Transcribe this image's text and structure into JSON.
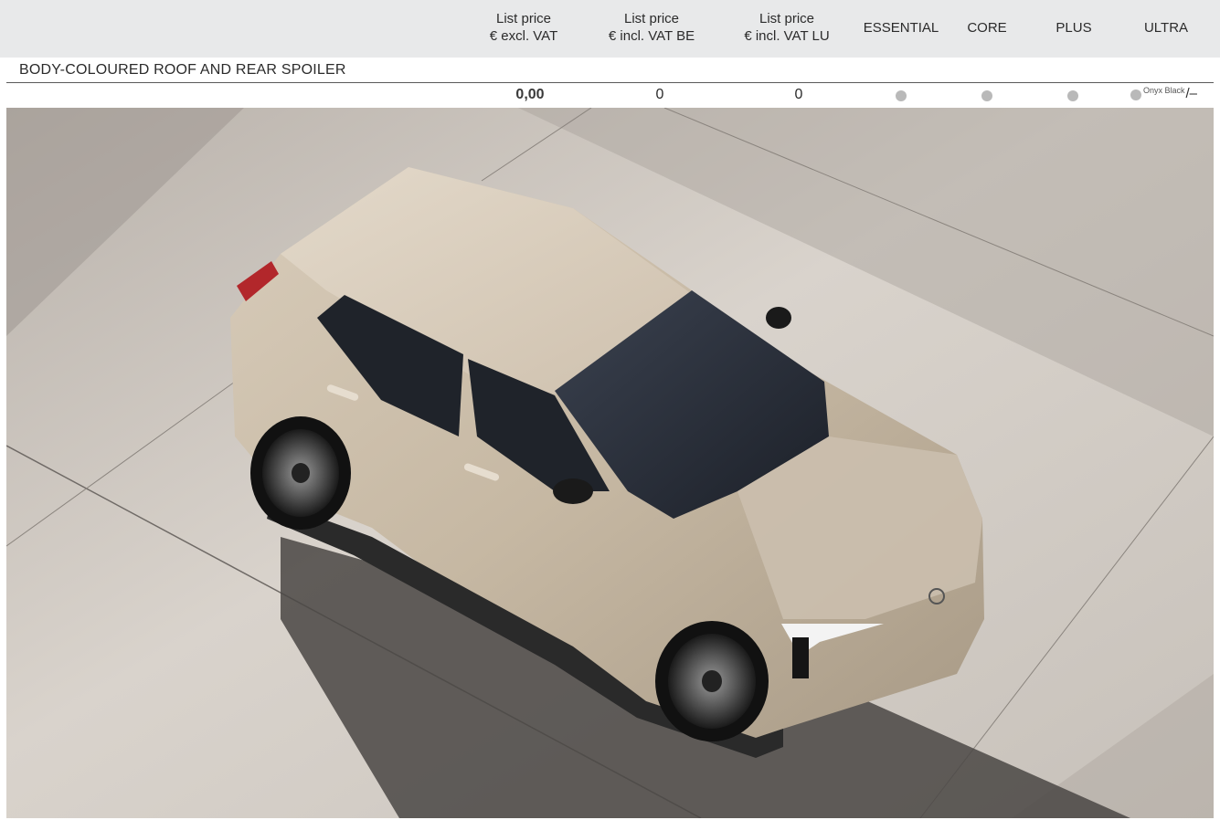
{
  "header": {
    "columns": [
      {
        "line1": "List price",
        "line2": "€ excl. VAT"
      },
      {
        "line1": "List price",
        "line2": "€ incl. VAT BE"
      },
      {
        "line1": "List price",
        "line2": "€ incl. VAT LU"
      },
      {
        "line1": "ESSENTIAL",
        "line2": ""
      },
      {
        "line1": "CORE",
        "line2": ""
      },
      {
        "line1": "PLUS",
        "line2": ""
      },
      {
        "line1": "ULTRA",
        "line2": ""
      }
    ]
  },
  "section": {
    "title": "BODY-COLOURED ROOF AND REAR SPOILER"
  },
  "row": {
    "price_excl_vat": "0,00",
    "price_incl_vat_be": "0",
    "price_incl_vat_lu": "0",
    "essential": "standard-dot",
    "core": "standard-dot",
    "plus": "standard-dot",
    "ultra_note": "Onyx Black",
    "ultra_suffix": "/–"
  },
  "colors": {
    "header_bg": "#e8e9ea",
    "dot": "#b9b9b9",
    "car_body": "#c9bba6",
    "floor": "#cfc9c2"
  },
  "image": {
    "subject": "car-photo"
  }
}
